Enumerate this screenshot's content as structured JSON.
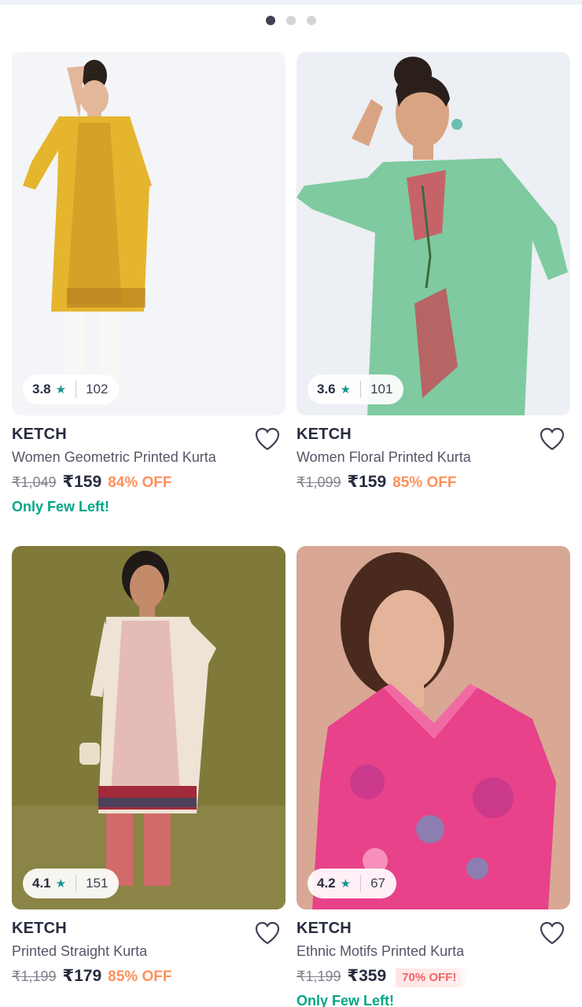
{
  "carousel": {
    "dots": 3,
    "active_index": 0
  },
  "products": [
    {
      "brand": "KETCH",
      "title": "Women Geometric Printed Kurta",
      "mrp": "₹1,049",
      "price": "₹159",
      "discount": "84% OFF",
      "discount_style": "text",
      "stock_note": "Only Few Left!",
      "rating": "3.8",
      "rating_count": "102",
      "image_desc": "yellow-kurta-model"
    },
    {
      "brand": "KETCH",
      "title": "Women Floral Printed Kurta",
      "mrp": "₹1,099",
      "price": "₹159",
      "discount": "85% OFF",
      "discount_style": "text",
      "stock_note": "",
      "rating": "3.6",
      "rating_count": "101",
      "image_desc": "green-kurta-model"
    },
    {
      "brand": "KETCH",
      "title": "Printed Straight Kurta",
      "mrp": "₹1,199",
      "price": "₹179",
      "discount": "85% OFF",
      "discount_style": "text",
      "stock_note": "",
      "rating": "4.1",
      "rating_count": "151",
      "image_desc": "cream-kurta-model"
    },
    {
      "brand": "KETCH",
      "title": "Ethnic Motifs Printed Kurta",
      "mrp": "₹1,199",
      "price": "₹359",
      "discount": "70% OFF!",
      "discount_style": "badge",
      "stock_note": "Only Few Left!",
      "rating": "4.2",
      "rating_count": "67",
      "image_desc": "pink-kurta-model"
    }
  ],
  "colors": {
    "accent_offer": "#ff905a",
    "stock_green": "#03a685",
    "star_teal": "#14958f",
    "badge_red": "#f16565"
  }
}
